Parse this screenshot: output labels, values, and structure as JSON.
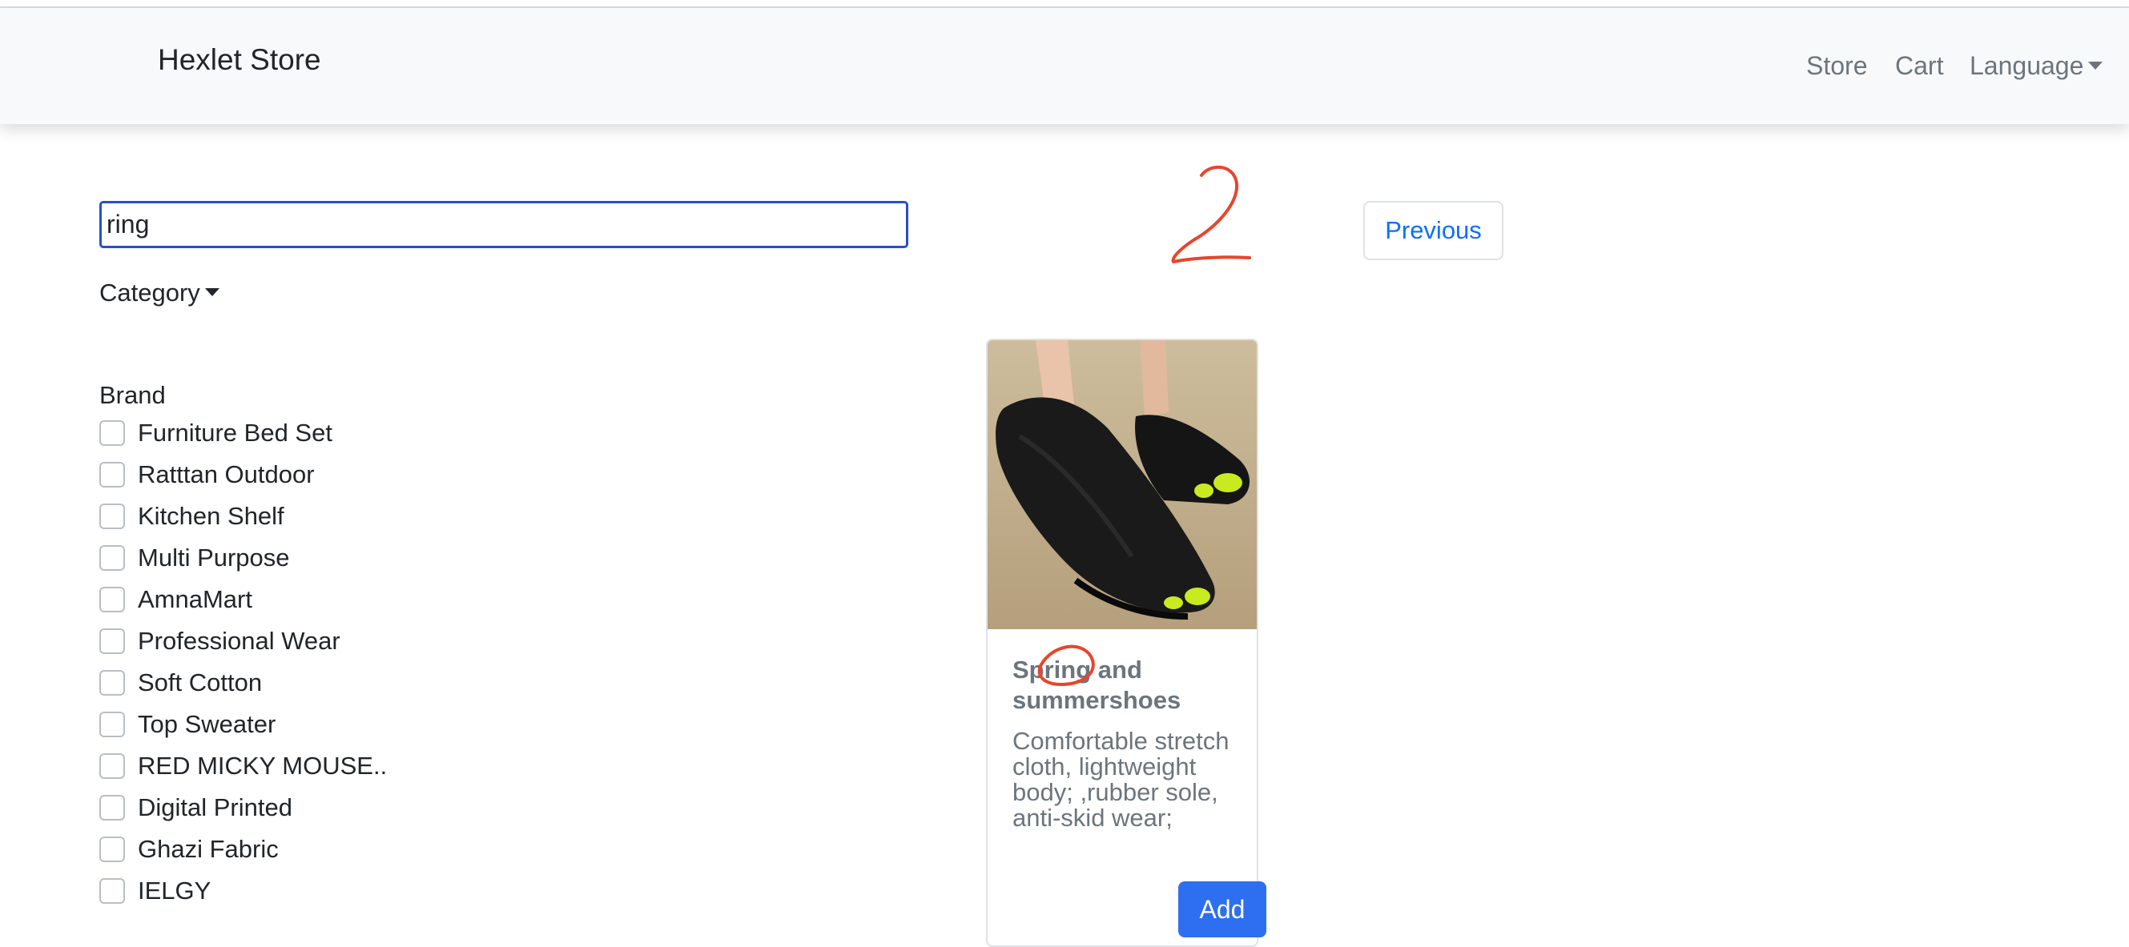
{
  "navbar": {
    "brand": "Hexlet Store",
    "links": {
      "store": "Store",
      "cart": "Cart",
      "language": "Language"
    }
  },
  "search": {
    "value": "ring"
  },
  "filters": {
    "category_label": "Category",
    "brand_title": "Brand",
    "brands": [
      "Furniture Bed Set",
      "Ratttan Outdoor",
      "Kitchen Shelf",
      "Multi Purpose",
      "AmnaMart",
      "Professional Wear",
      "Soft Cotton",
      "Top Sweater",
      "RED MICKY MOUSE..",
      "Digital Printed",
      "Ghazi Fabric",
      "IELGY"
    ]
  },
  "pagination": {
    "previous_label": "Previous"
  },
  "product": {
    "title": "Spring and summershoes",
    "description": "Comfortable stretch cloth, lightweight body; ,rubber sole, anti-skid wear;",
    "add_label": "Add"
  },
  "annotation": {
    "handwritten_number": "2"
  },
  "colors": {
    "accent": "#0d6efd",
    "annotation": "#e8452c",
    "navbar_bg": "#f8f9fa"
  }
}
